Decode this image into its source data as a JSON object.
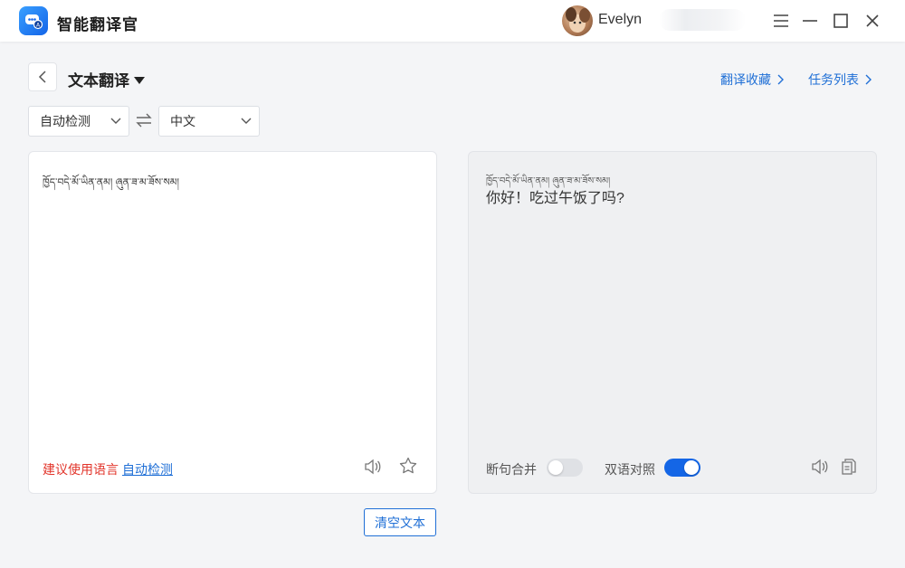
{
  "app": {
    "title": "智能翻译官",
    "accent": "#1f6fd6"
  },
  "user": {
    "name": "Evelyn"
  },
  "window_controls": [
    "menu-icon",
    "minimize-icon",
    "maximize-icon",
    "close-icon"
  ],
  "page": {
    "title": "文本翻译"
  },
  "links": {
    "favorites": "翻译收藏",
    "tasks": "任务列表"
  },
  "languages": {
    "source": "自动检测",
    "target": "中文"
  },
  "input": {
    "text": "ཁྱོད་བདེ་མོ་ཡིན་ནམ། ཞུན་ཟ་མ་ཟོས་སམ།"
  },
  "suggestion": {
    "prefix": "建议使用语言",
    "link": "自动检测"
  },
  "output": {
    "source_echo": "ཁྱོད་བདེ་མོ་ཡིན་ནམ། ཞུན་ཟ་མ་ཟོས་སམ།",
    "translation": "你好！吃过午饭了吗?"
  },
  "toggles": {
    "merge": {
      "label": "断句合并",
      "state": "off"
    },
    "bilingual": {
      "label": "双语对照",
      "state": "on"
    }
  },
  "actions": {
    "clear": "清空文本"
  }
}
